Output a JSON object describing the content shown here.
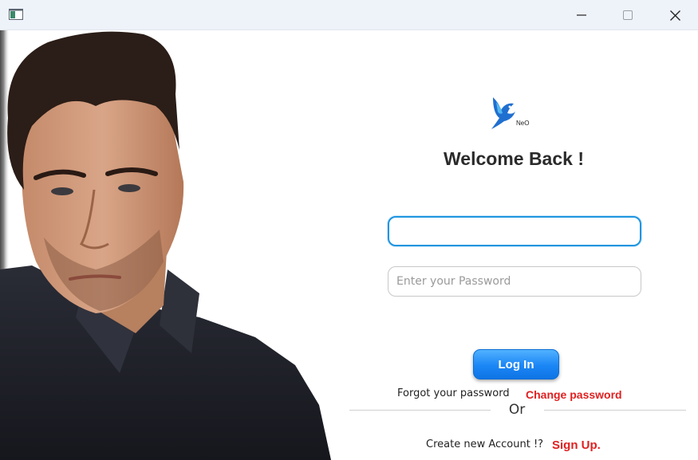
{
  "window": {
    "icons": {
      "app": "app-window-icon",
      "minimize": "minimize-icon",
      "maximize": "maximize-icon",
      "close": "close-icon"
    }
  },
  "hero": {
    "image": "man-portrait-photo"
  },
  "logo": {
    "icon": "bird-logo-icon",
    "text": "NeO"
  },
  "login": {
    "welcome": "Welcome Back !",
    "username_value": "",
    "password_placeholder": "Enter your Password",
    "login_button": "Log In",
    "forgot_text": "Forgot your password",
    "change_password": "Change password",
    "or_text": "Or",
    "create_text": "Create new Account !?",
    "signup": "Sign Up."
  },
  "colors": {
    "accent": "#1a86f5",
    "link": "#e02020",
    "focus_border": "#1d95e0",
    "titlebar": "#eef2f9"
  }
}
